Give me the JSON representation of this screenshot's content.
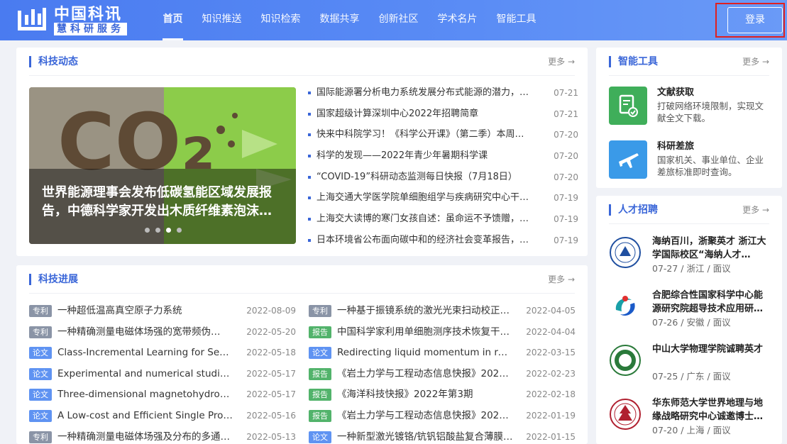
{
  "header": {
    "logo_title": "中国科讯",
    "logo_subtitle": "慧科研服务",
    "nav": [
      "首页",
      "知识推送",
      "知识检索",
      "数据共享",
      "创新社区",
      "学术名片",
      "智能工具"
    ],
    "login_label": "登录"
  },
  "tech_news": {
    "title": "科技动态",
    "more": "更多 →",
    "carousel_caption": "世界能源理事会发布低碳氢能区域发展报告，中德科学家开发出木质纤维素泡沫…",
    "carousel_image_text": "CO₂",
    "items": [
      {
        "title": "国际能源署分析电力系统发展分布式能源的潜力，…",
        "date": "07-21"
      },
      {
        "title": "国家超级计算深圳中心2022年招聘简章",
        "date": "07-21"
      },
      {
        "title": "快来中科院学习！《科学公开课》（第二季）本周…",
        "date": "07-20"
      },
      {
        "title": "科学的发现——2022年青少年暑期科学课",
        "date": "07-20"
      },
      {
        "title": "“COVID-19”科研动态监测每日快报（7月18日）",
        "date": "07-20"
      },
      {
        "title": "上海交通大学医学院单细胞组学与疾病研究中心干…",
        "date": "07-19"
      },
      {
        "title": "上海交大读博的寒门女孩自述：虽命运不予馈赠，…",
        "date": "07-19"
      },
      {
        "title": "日本环境省公布面向碳中和的经济社会变革报告，…",
        "date": "07-19"
      }
    ]
  },
  "tech_progress": {
    "title": "科技进展",
    "more": "更多 →",
    "left": [
      {
        "tag": "专利",
        "tag_color": "gray",
        "title": "一种超低温高真空原子力系统",
        "date": "2022-08-09"
      },
      {
        "tag": "专利",
        "tag_color": "gray",
        "title": "一种精确测量电磁体场强的宽带频伪…",
        "date": "2022-05-20"
      },
      {
        "tag": "论文",
        "tag_color": "blue",
        "title": "Class-Incremental Learning for Sema…",
        "date": "2022-05-18"
      },
      {
        "tag": "论文",
        "tag_color": "blue",
        "title": "Experimental and numerical studies …",
        "date": "2022-05-17"
      },
      {
        "tag": "论文",
        "tag_color": "blue",
        "title": "Three-dimensional magnetohydrody…",
        "date": "2022-05-17"
      },
      {
        "tag": "论文",
        "tag_color": "blue",
        "title": "A Low-cost and Efficient Single Prob…",
        "date": "2022-05-16"
      },
      {
        "tag": "专利",
        "tag_color": "gray",
        "title": "一种精确测量电磁体场强及分布的多通…",
        "date": "2022-05-13"
      }
    ],
    "right": [
      {
        "tag": "专利",
        "tag_color": "gray",
        "title": "一种基于振镜系统的激光光束扫动校正…",
        "date": "2022-04-05"
      },
      {
        "tag": "报告",
        "tag_color": "green",
        "title": "中国科学家利用单细胞测序技术恢复干…",
        "date": "2022-04-04"
      },
      {
        "tag": "论文",
        "tag_color": "blue",
        "title": "Redirecting liquid momentum in rot…",
        "date": "2022-03-15"
      },
      {
        "tag": "报告",
        "tag_color": "green",
        "title": "《岩土力学与工程动态信息快报》2022…",
        "date": "2022-02-23"
      },
      {
        "tag": "报告",
        "tag_color": "green",
        "title": "《海洋科技快报》2022年第3期",
        "date": "2022-02-18"
      },
      {
        "tag": "报告",
        "tag_color": "green",
        "title": "《岩土力学与工程动态信息快报》2021…",
        "date": "2022-01-19"
      },
      {
        "tag": "论文",
        "tag_color": "blue",
        "title": "一种新型激光镀铬/钪钒铝酸盐复合薄膜…",
        "date": "2022-01-15"
      }
    ]
  },
  "smart_tools": {
    "title": "智能工具",
    "more": "更多 →",
    "items": [
      {
        "name": "文献获取",
        "desc": "打破网络环境限制，实现文献全文下载。",
        "icon": "document-check-icon",
        "color": "#3fae5a"
      },
      {
        "name": "科研差旅",
        "desc": "国家机关、事业单位、企业差旅标准即时查询。",
        "icon": "airplane-icon",
        "color": "#3a9ae8"
      }
    ]
  },
  "jobs": {
    "title": "人才招聘",
    "more": "更多 →",
    "items": [
      {
        "title": "海纳百川，浙聚英才 浙江大学国际校区“海纳人才…",
        "meta": "07-27 / 浙江 / 面议",
        "icon": "zju-seal-icon"
      },
      {
        "title": "合肥综合性国家科学中心能源研究院超导技术应用研…",
        "meta": "07-26 / 安徽 / 面议",
        "icon": "hefei-logo-icon"
      },
      {
        "title": "中山大学物理学院诚聘英才",
        "meta": "07-25 / 广东 / 面议",
        "icon": "sysu-seal-icon"
      },
      {
        "title": "华东师范大学世界地理与地缘战略研究中心诚邀博士…",
        "meta": "07-20 / 上海 / 面议",
        "icon": "ecnu-seal-icon"
      }
    ]
  },
  "colors": {
    "accent": "#3a66d8",
    "header": "#5a8cf5",
    "tag_gray": "#8a94a6",
    "tag_green": "#52b36b",
    "tag_blue": "#5f93f2"
  }
}
